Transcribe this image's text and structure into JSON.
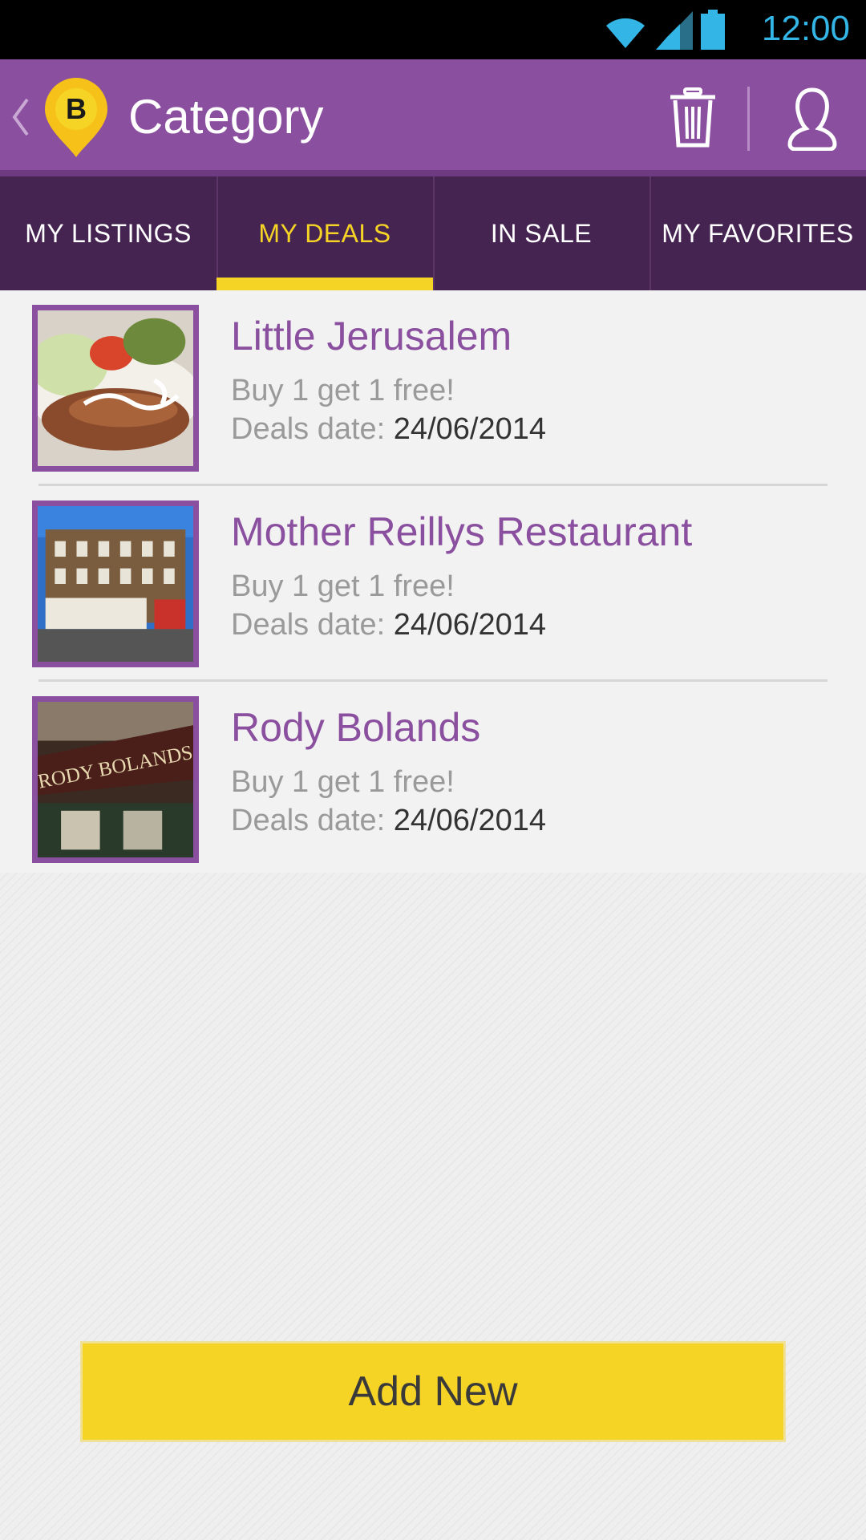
{
  "status_bar": {
    "time": "12:00",
    "icons": [
      "wifi-icon",
      "signal-icon",
      "battery-icon"
    ],
    "accent": "#33b5e5"
  },
  "action_bar": {
    "title": "Category",
    "logo_letter": "B",
    "icons": [
      "back-chevron-icon",
      "trash-icon",
      "user-icon"
    ],
    "background": "#8a4f9e"
  },
  "tabs": [
    {
      "label": "MY LISTINGS",
      "active": false
    },
    {
      "label": "MY DEALS",
      "active": true
    },
    {
      "label": "IN SALE",
      "active": false
    },
    {
      "label": "MY FAVORITES",
      "active": false
    }
  ],
  "deals": [
    {
      "name": "Little Jerusalem",
      "offer": "Buy 1 get 1 free!",
      "date_label": "Deals date:",
      "date": "24/06/2014"
    },
    {
      "name": "Mother Reillys Restaurant",
      "offer": "Buy 1 get 1 free!",
      "date_label": "Deals date:",
      "date": "24/06/2014"
    },
    {
      "name": "Rody Bolands",
      "offer": "Buy 1 get 1 free!",
      "date_label": "Deals date:",
      "date": "24/06/2014"
    }
  ],
  "thumbnail_signs": {
    "rody": "RODY BOLANDS"
  },
  "add_button": {
    "label": "Add New",
    "color": "#f6d426"
  },
  "colors": {
    "purple": "#8a4f9e",
    "dark_purple": "#452452",
    "yellow": "#f6d426"
  }
}
